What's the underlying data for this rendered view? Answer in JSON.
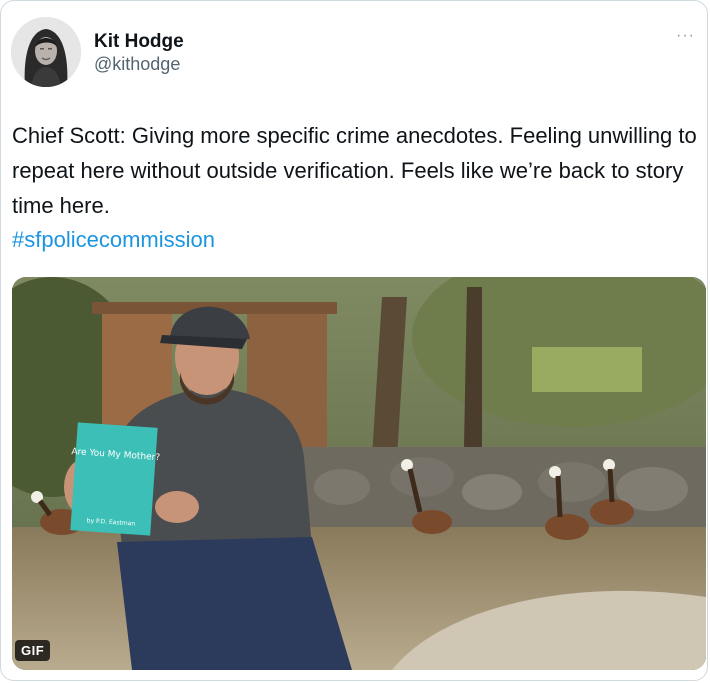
{
  "tweet": {
    "author_name": "Kit Hodge",
    "author_handle": "@kithodge",
    "more_label": "···",
    "text": "Chief Scott: Giving more specific crime anecdotes. Feeling unwilling to repeat here without outside verification. Feels like we’re back to story time here.",
    "hashtag": "#sfpolicecommission"
  },
  "media": {
    "badge": "GIF",
    "book_title": "Are You My Mother?",
    "book_author": "by P.D. Eastman"
  },
  "colors": {
    "link": "#1b95e0",
    "secondary_text": "#536471",
    "border": "#cfd9de"
  }
}
